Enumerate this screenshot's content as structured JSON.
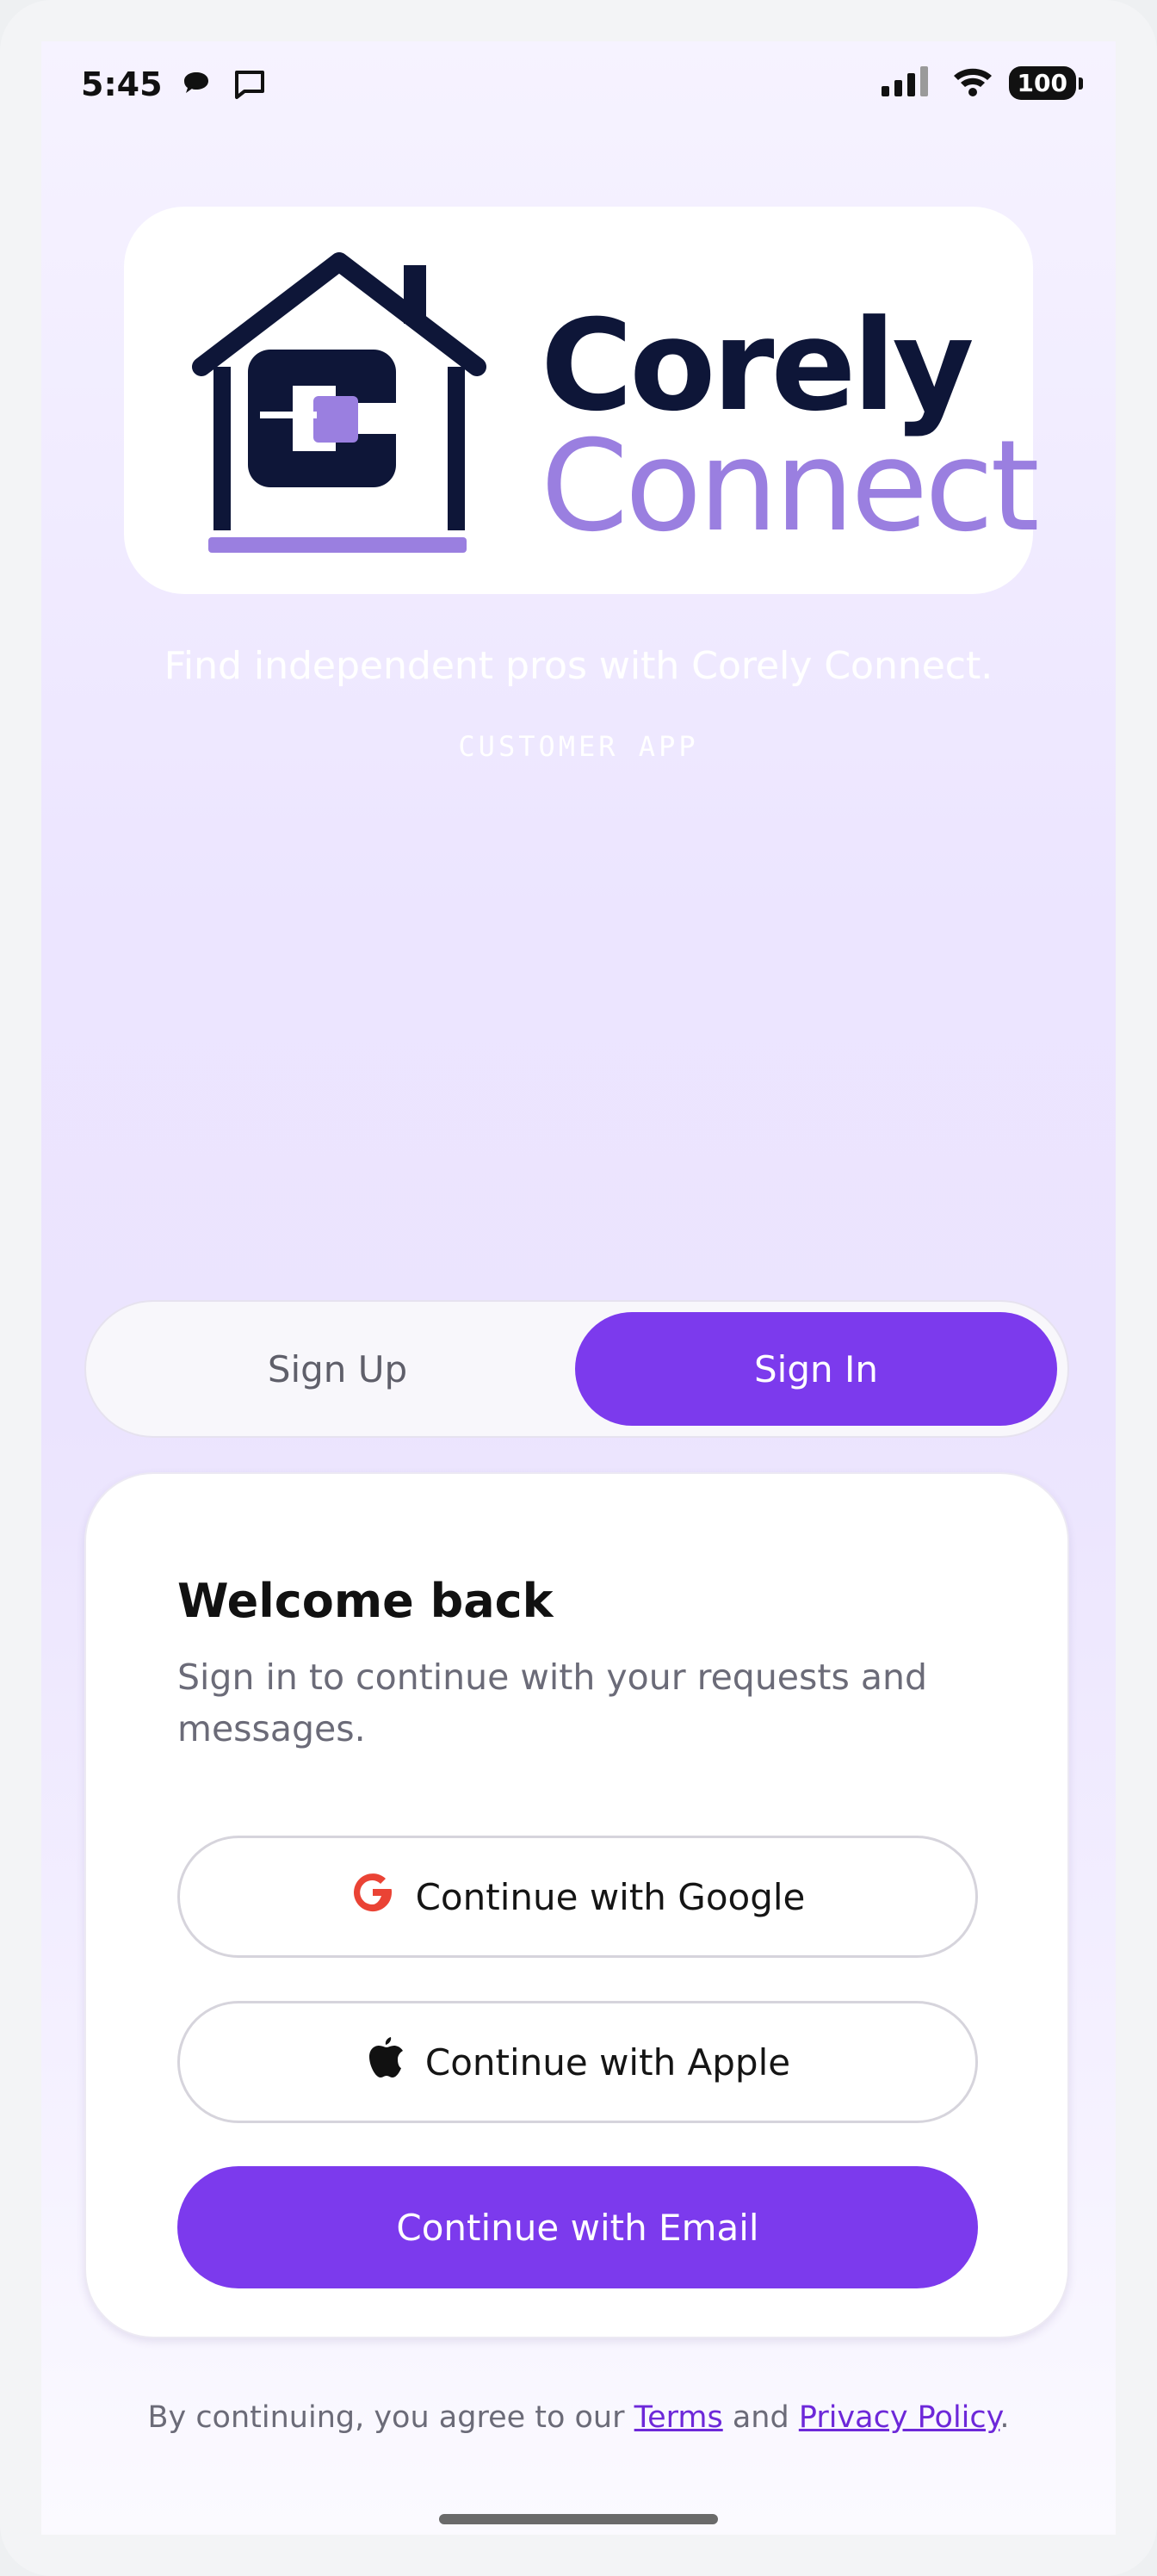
{
  "status_bar": {
    "time": "5:45",
    "battery": "100",
    "icons": [
      "chat-bubble-icon",
      "message-icon",
      "signal-icon",
      "wifi-icon",
      "battery-icon"
    ]
  },
  "logo": {
    "word_top": "Corely",
    "word_bottom": "Connect",
    "icon": "house-logo-icon",
    "colors": {
      "navy": "#0e1638",
      "lavender": "#9a7fe0"
    }
  },
  "hero": {
    "tagline": "Find independent pros with Corely Connect.",
    "app_label": "CUSTOMER APP"
  },
  "tabs": {
    "sign_up": "Sign Up",
    "sign_in": "Sign In",
    "active": "Sign In"
  },
  "card": {
    "title": "Welcome back",
    "subtitle": "Sign in to continue with your requests and messages.",
    "google_label": "Continue with Google",
    "apple_label": "Continue with Apple",
    "email_label": "Continue with Email"
  },
  "legal": {
    "prefix": "By continuing, you agree to our ",
    "terms": "Terms",
    "and": " and ",
    "privacy": "Privacy Policy",
    "suffix": "."
  },
  "colors": {
    "accent": "#7c3aed",
    "google_red": "#ea4335"
  }
}
